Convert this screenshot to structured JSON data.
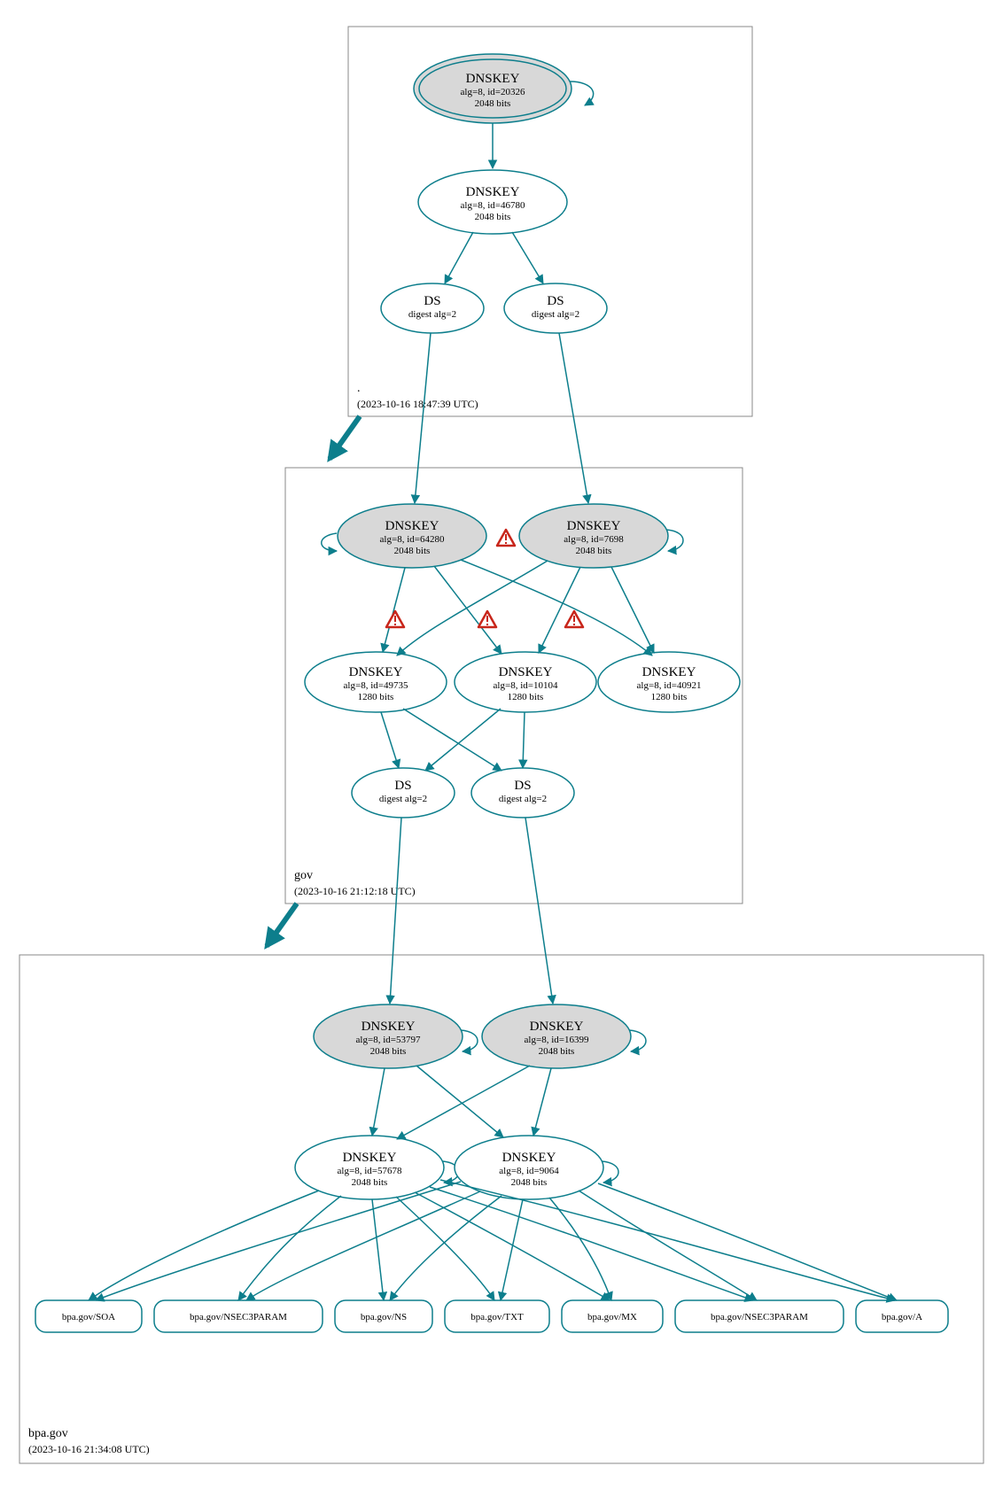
{
  "colors": {
    "teal": "#0d7e8c",
    "fillGray": "#d8d8d8",
    "boxStroke": "#888888",
    "warn": "#c8261b"
  },
  "zones": {
    "root": {
      "name": ".",
      "timestamp": "(2023-10-16 18:47:39 UTC)"
    },
    "gov": {
      "name": "gov",
      "timestamp": "(2023-10-16 21:12:18 UTC)"
    },
    "bpa": {
      "name": "bpa.gov",
      "timestamp": "(2023-10-16 21:34:08 UTC)"
    }
  },
  "nodes": {
    "root_ksk": {
      "title": "DNSKEY",
      "line1": "alg=8, id=20326",
      "line2": "2048 bits"
    },
    "root_zsk": {
      "title": "DNSKEY",
      "line1": "alg=8, id=46780",
      "line2": "2048 bits"
    },
    "root_ds1": {
      "title": "DS",
      "line1": "digest alg=2"
    },
    "root_ds2": {
      "title": "DS",
      "line1": "digest alg=2"
    },
    "gov_ksk1": {
      "title": "DNSKEY",
      "line1": "alg=8, id=64280",
      "line2": "2048 bits"
    },
    "gov_ksk2": {
      "title": "DNSKEY",
      "line1": "alg=8, id=7698",
      "line2": "2048 bits"
    },
    "gov_zsk1": {
      "title": "DNSKEY",
      "line1": "alg=8, id=49735",
      "line2": "1280 bits"
    },
    "gov_zsk2": {
      "title": "DNSKEY",
      "line1": "alg=8, id=10104",
      "line2": "1280 bits"
    },
    "gov_zsk3": {
      "title": "DNSKEY",
      "line1": "alg=8, id=40921",
      "line2": "1280 bits"
    },
    "gov_ds1": {
      "title": "DS",
      "line1": "digest alg=2"
    },
    "gov_ds2": {
      "title": "DS",
      "line1": "digest alg=2"
    },
    "bpa_ksk1": {
      "title": "DNSKEY",
      "line1": "alg=8, id=53797",
      "line2": "2048 bits"
    },
    "bpa_ksk2": {
      "title": "DNSKEY",
      "line1": "alg=8, id=16399",
      "line2": "2048 bits"
    },
    "bpa_zsk1": {
      "title": "DNSKEY",
      "line1": "alg=8, id=57678",
      "line2": "2048 bits"
    },
    "bpa_zsk2": {
      "title": "DNSKEY",
      "line1": "alg=8, id=9064",
      "line2": "2048 bits"
    }
  },
  "rr": {
    "r1": "bpa.gov/SOA",
    "r2": "bpa.gov/NSEC3PARAM",
    "r3": "bpa.gov/NS",
    "r4": "bpa.gov/TXT",
    "r5": "bpa.gov/MX",
    "r6": "bpa.gov/NSEC3PARAM",
    "r7": "bpa.gov/A"
  }
}
